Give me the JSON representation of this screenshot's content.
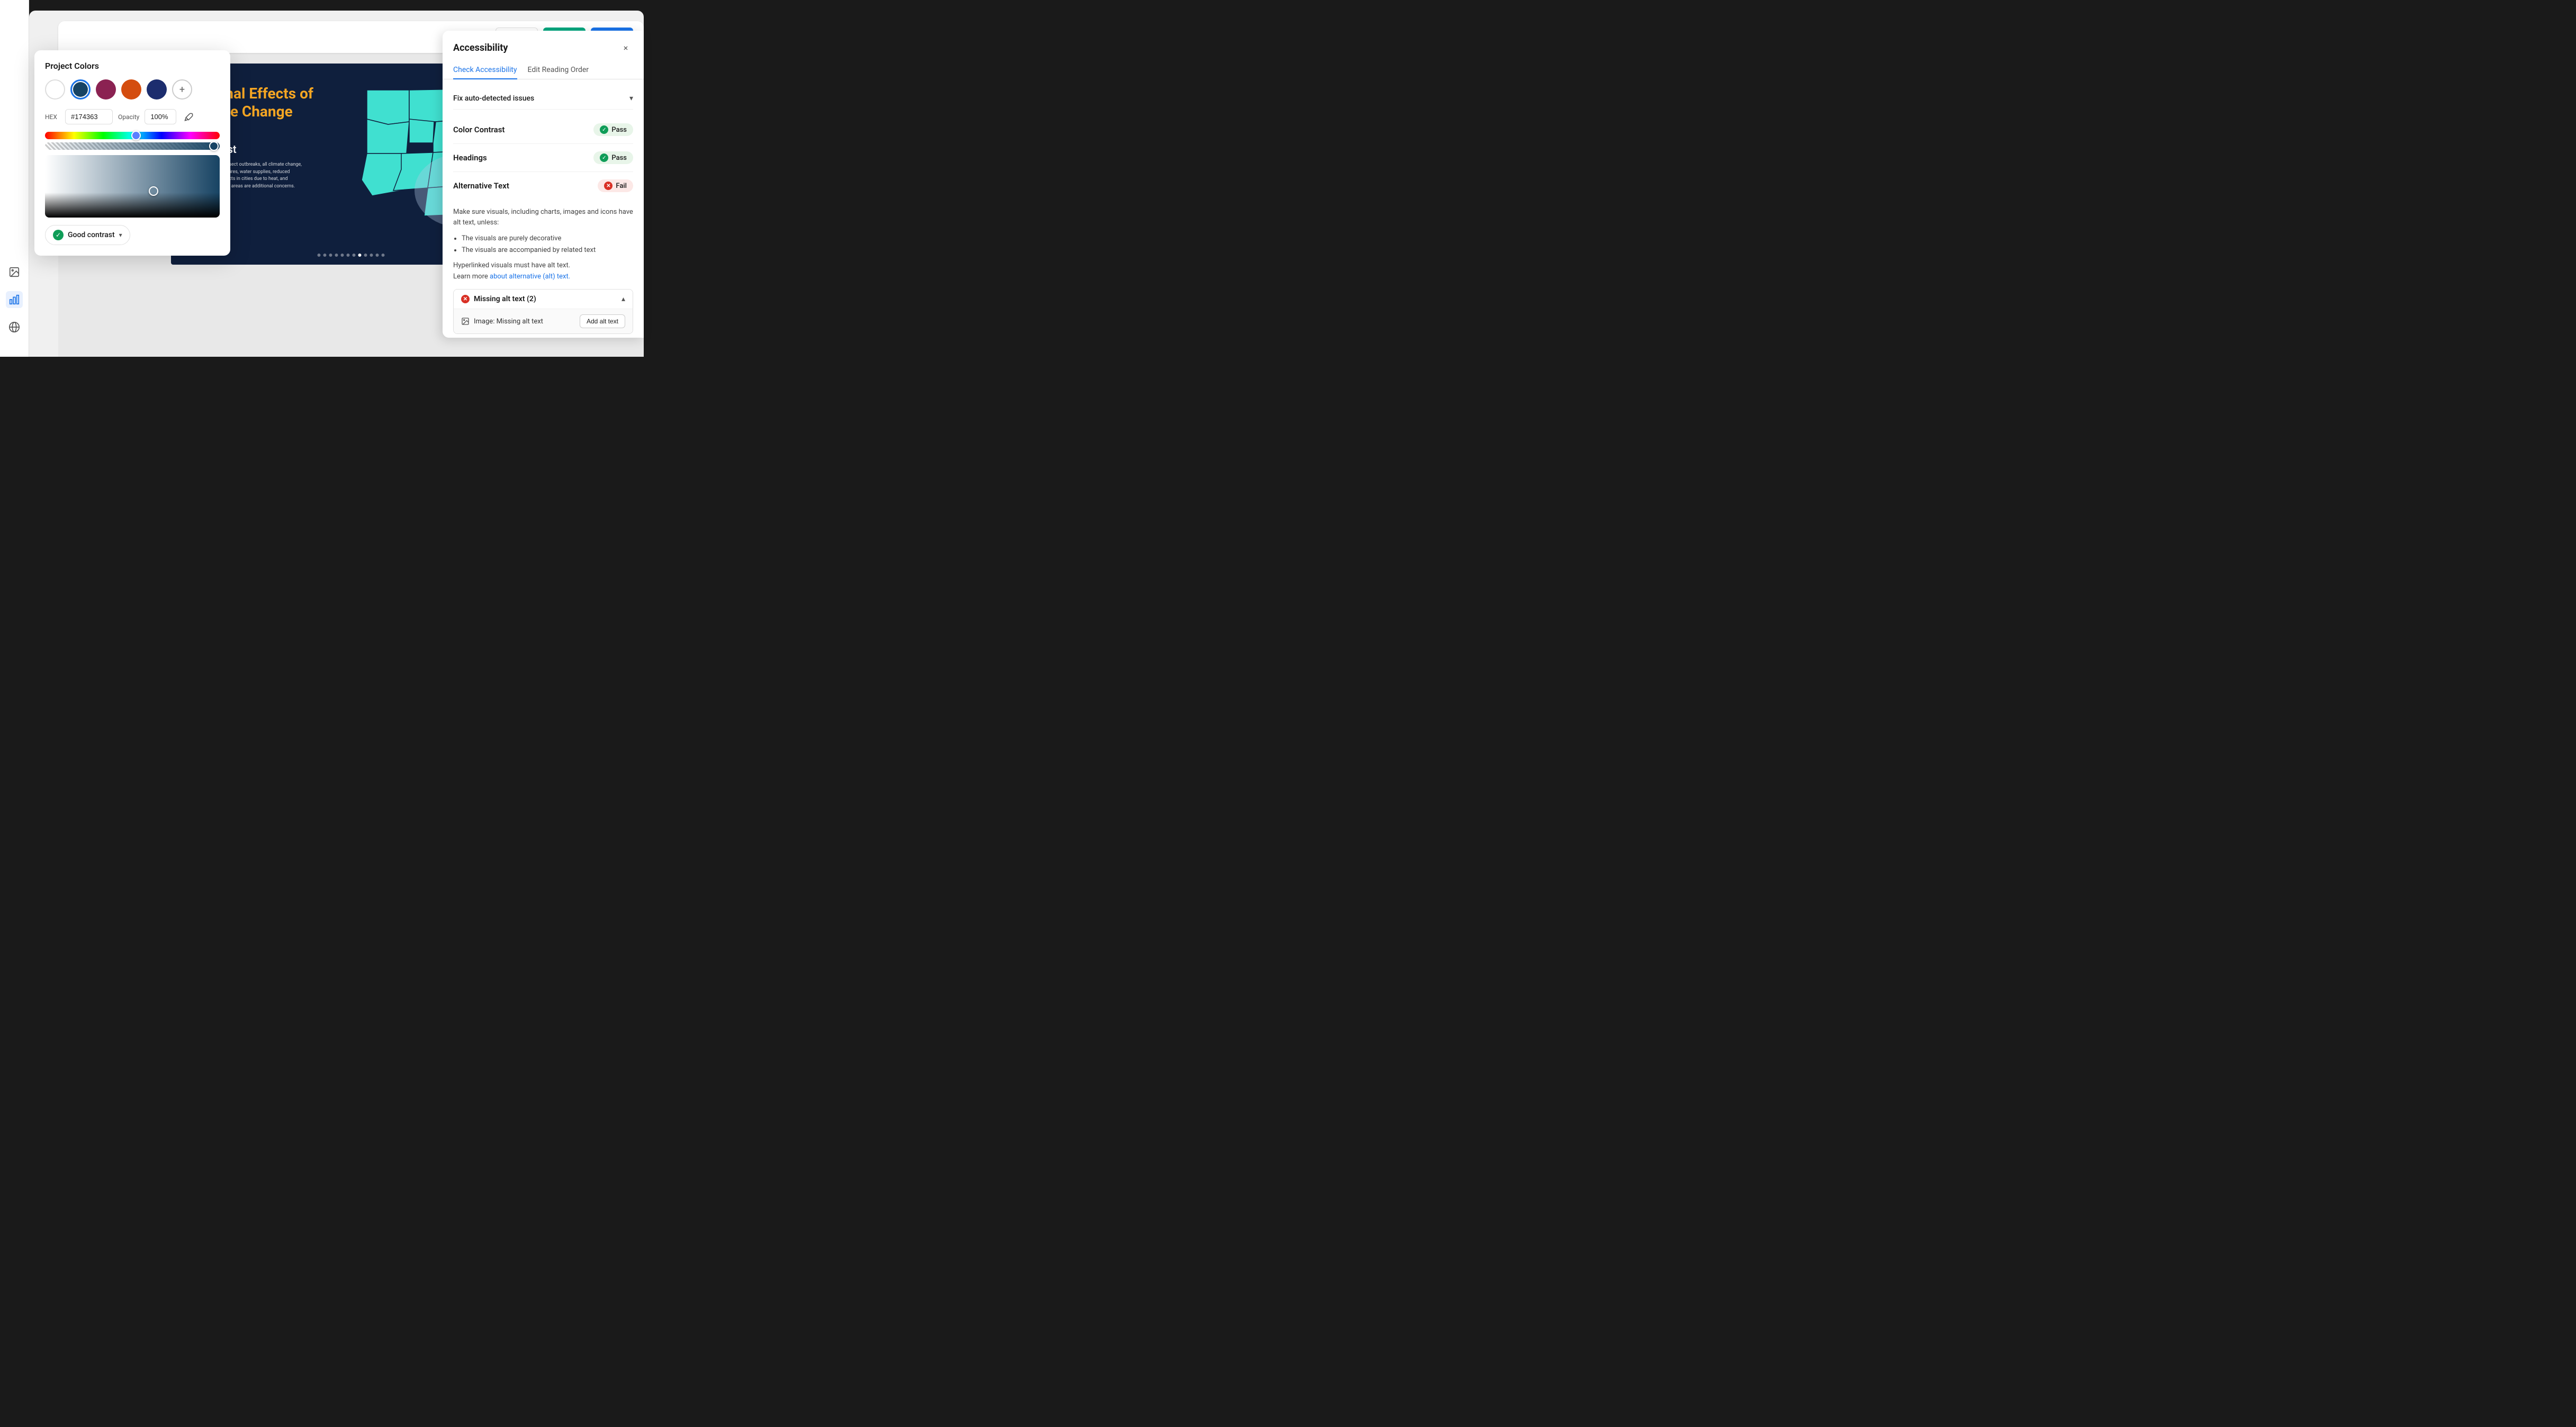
{
  "toolbar": {
    "color_swatches": [
      {
        "label": "white swatch",
        "color": "#ffffff"
      },
      {
        "label": "teal swatch",
        "color": "#00a67e"
      },
      {
        "label": "blue swatch",
        "color": "#1a73e8"
      }
    ]
  },
  "color_picker": {
    "title": "Project Colors",
    "swatches": [
      {
        "label": "white",
        "color": "#ffffff",
        "class": "white"
      },
      {
        "label": "dark blue",
        "color": "#174363",
        "class": "dark-blue",
        "selected": true
      },
      {
        "label": "maroon",
        "color": "#8b2252",
        "class": "maroon"
      },
      {
        "label": "orange",
        "color": "#d44d0f",
        "class": "orange"
      },
      {
        "label": "navy",
        "color": "#1c2d6e",
        "class": "navy"
      }
    ],
    "add_button_label": "+",
    "hex_label": "HEX",
    "hex_value": "#174363",
    "opacity_label": "Opacity",
    "opacity_value": "100%",
    "contrast_badge_label": "Good contrast",
    "contrast_chevron": "▾"
  },
  "slide": {
    "title": "Regional Effects of Climate Change",
    "subtitle": "Northwest",
    "body_text": "heat, drought and insect outbreaks, all climate change, have increased wildfires, water supplies, reduced agricultural yields, acts in cities due to heat, and flooding and coastal areas are additional concerns."
  },
  "accessibility": {
    "title": "Accessibility",
    "close_label": "×",
    "tabs": [
      {
        "label": "Check Accessibility",
        "active": true
      },
      {
        "label": "Edit Reading Order",
        "active": false
      }
    ],
    "auto_detect_label": "Fix auto-detected issues",
    "checks": [
      {
        "name": "Color Contrast",
        "status": "Pass",
        "pass": true
      },
      {
        "name": "Headings",
        "status": "Pass",
        "pass": true
      },
      {
        "name": "Alternative Text",
        "status": "Fail",
        "pass": false,
        "description": "Make sure visuals, including charts, images and icons have alt text, unless:",
        "bullets": [
          "The visuals are purely decorative",
          "The visuals are accompanied by related text"
        ],
        "hyperlink_note": "Hyperlinked visuals must have alt text.",
        "learn_more_text": "Learn more ",
        "learn_more_link_text": "about alternative (alt) text.",
        "learn_more_url": "#"
      }
    ],
    "missing_alt": {
      "label": "Missing alt text (2)",
      "item_label": "Image: Missing alt text",
      "add_button_label": "Add alt text"
    }
  },
  "sidebar": {
    "icons": [
      {
        "name": "image-icon",
        "label": "Image"
      },
      {
        "name": "chart-icon",
        "label": "Chart",
        "active": true
      },
      {
        "name": "globe-icon",
        "label": "Globe"
      }
    ]
  }
}
